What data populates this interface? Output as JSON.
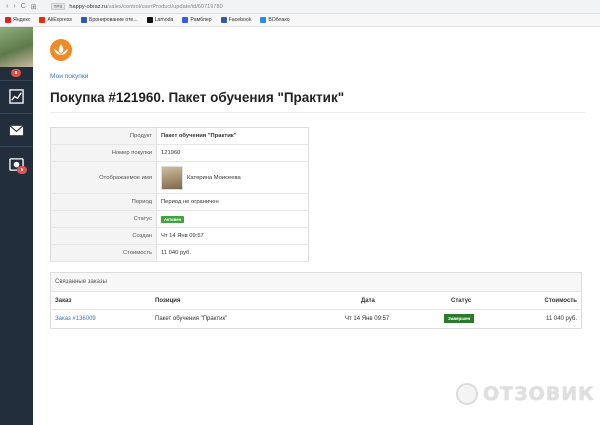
{
  "browser": {
    "nav_back": "‹",
    "nav_forward": "›",
    "nav_reload": "C",
    "nav_grid": "⊞",
    "protocol_badge": "TPS",
    "url_domain": "happy-obraz.ru",
    "url_path": "/sales/control/userProduct/update/id/60719780"
  },
  "bookmarks": [
    {
      "label": "Яндекс",
      "icon": "yandex-icon",
      "color": "#e02020"
    },
    {
      "label": "AliExpress",
      "icon": "aliexpress-icon",
      "color": "#e62e04"
    },
    {
      "label": "Бронирование оте...",
      "icon": "booking-icon",
      "color": "#2a5aa8"
    },
    {
      "label": "Lamoda",
      "icon": "lamoda-icon",
      "color": "#111111"
    },
    {
      "label": "Рамблер",
      "icon": "rambler-icon",
      "color": "#3b5bdb"
    },
    {
      "label": "Facebook",
      "icon": "facebook-icon",
      "color": "#3b5998"
    },
    {
      "label": "ВОблако",
      "icon": "cloud-icon",
      "color": "#2b8be6"
    }
  ],
  "sidebar": {
    "avatar_badge": "8",
    "product_badge": "5"
  },
  "breadcrumb": "Мои покупки",
  "page_title": "Покупка #121960. Пакет обучения \"Практик\"",
  "details": {
    "product_label": "Продукт",
    "product_value": "Пакет обучения \"Практик\"",
    "purchase_no_label": "Номер покупки",
    "purchase_no_value": "121960",
    "display_name_label": "Отображаемое имя",
    "display_name_value": "Катерина Моисеева",
    "period_label": "Период",
    "period_value": "Период не ограничен",
    "status_label": "Статус",
    "status_value": "Активен",
    "created_label": "Создан",
    "created_value": "Чт 14 Янв 09:57",
    "cost_label": "Стоимость",
    "cost_value": "11 040 руб."
  },
  "related": {
    "title": "Связанные заказы",
    "col_order": "Заказ",
    "col_position": "Позиция",
    "col_date": "Дата",
    "col_status": "Статус",
    "col_cost": "Стоимость",
    "rows": [
      {
        "order": "Заказ #136009",
        "position": "Пакет обучения \"Практик\"",
        "date": "Чт 14 Янв 09:57",
        "status": "Завершен",
        "cost": "11 040 руб."
      }
    ]
  },
  "watermark": "ОТЗОВИК",
  "colors": {
    "sidebar": "#232e3c",
    "accent_link": "#3a7ab8",
    "status_active": "#3fa33f",
    "status_done": "#2a7a2a",
    "logo": "#f08a24"
  }
}
